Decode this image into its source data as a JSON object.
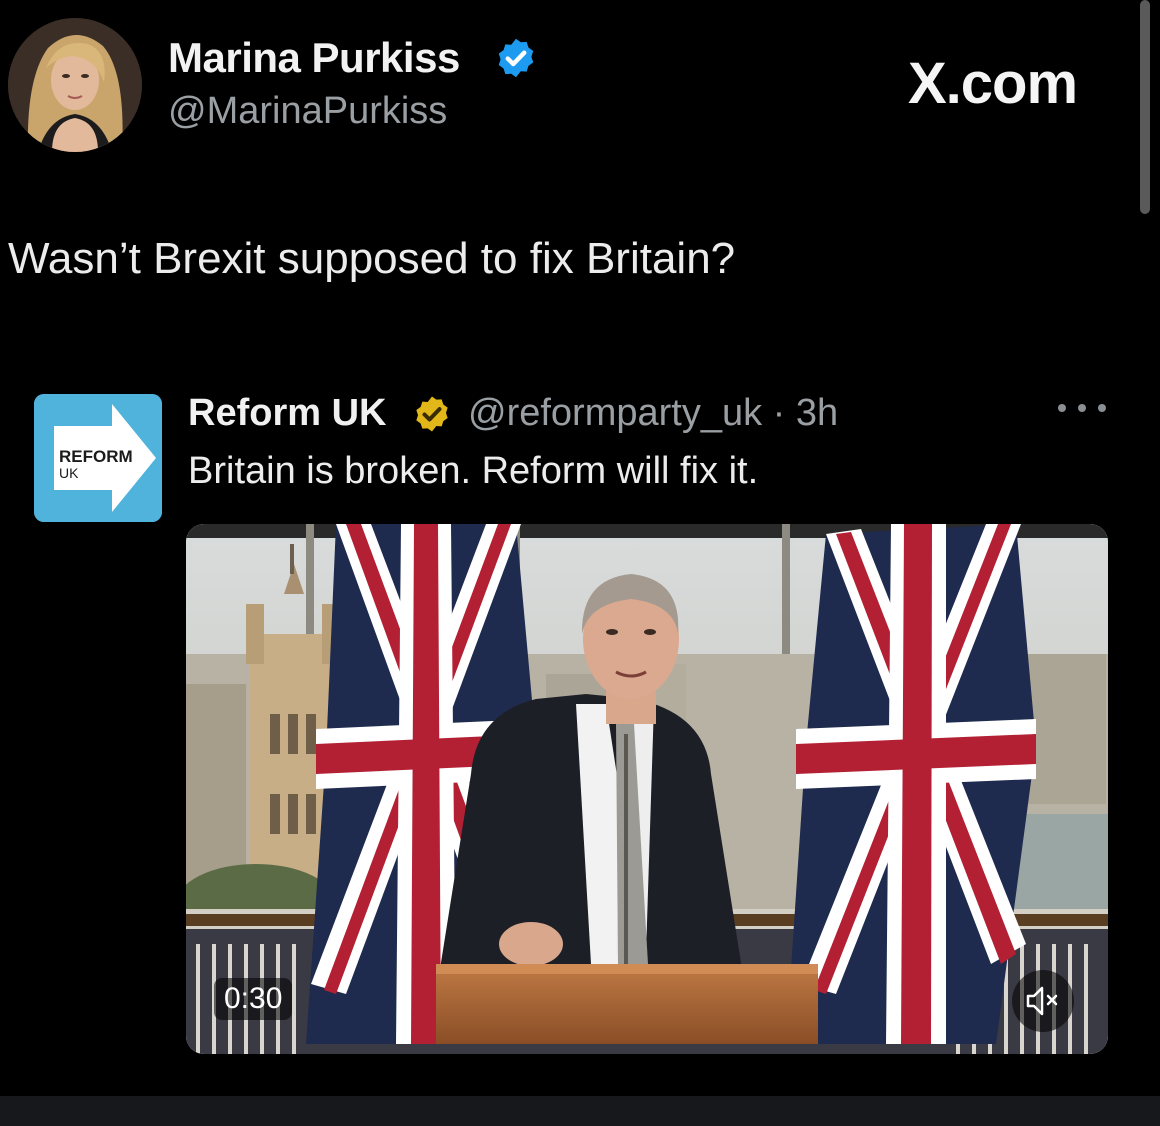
{
  "author": {
    "name": "Marina Purkiss",
    "handle": "@MarinaPurkiss",
    "verified_color": "#1d9bf0"
  },
  "site_label": "X.com",
  "tweet_text": "Wasn’t Brexit supposed to fix Britain?",
  "quoted_tweet": {
    "name": "Reform UK",
    "handle_time": "@reformparty_uk · 3h",
    "verified_color": "#e2b719",
    "text": "Britain is broken. Reform will fix it.",
    "logo": {
      "line1": "REFORM",
      "line2": "UK",
      "color": "#4fb3dc"
    },
    "video": {
      "duration": "0:30",
      "mute_icon": "speaker-muted-icon"
    },
    "more_icon": "more-options-icon"
  }
}
